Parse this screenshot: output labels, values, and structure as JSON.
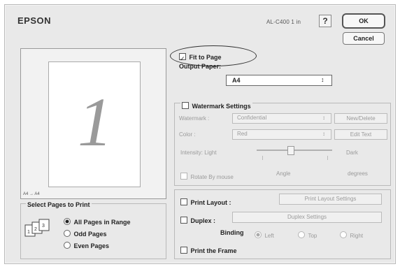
{
  "header": {
    "title": "EPSON",
    "model": "AL-C400 1 in",
    "help_label": "?",
    "ok_label": "OK",
    "cancel_label": "Cancel"
  },
  "preview": {
    "page_number": "1",
    "size_label": "A4 → A4"
  },
  "fit_to_page": {
    "label": "Fit to Page",
    "checked": true,
    "output_paper_label": "Output Paper:",
    "output_paper_value": "A4",
    "output_paper_arrow": "↕"
  },
  "watermark": {
    "label": "Watermark Settings",
    "checked": false,
    "watermark_label": "Watermark :",
    "watermark_value": "Confidential",
    "new_delete_label": "New/Delete",
    "color_label": "Color :",
    "color_value": "Red",
    "edit_text_label": "Edit Text",
    "intensity_label": "Intensity: Light",
    "intensity_dark": "Dark",
    "intensity_level": 0.45,
    "rotate_label": "Rotate By mouse",
    "angle_label": "Angle",
    "degrees_label": "degrees",
    "arrow": "↕"
  },
  "select_pages": {
    "title": "Select Pages to Print",
    "options": [
      "All Pages in Range",
      "Odd Pages",
      "Even Pages"
    ],
    "selected_index": 0
  },
  "layout": {
    "print_layout_label": "Print Layout :",
    "print_layout_settings_label": "Print Layout Settings",
    "duplex_label": "Duplex :",
    "duplex_settings_label": "Duplex Settings",
    "binding_label": "Binding",
    "binding_options": [
      "Left",
      "Top",
      "Right"
    ],
    "print_frame_label": "Print the Frame"
  }
}
